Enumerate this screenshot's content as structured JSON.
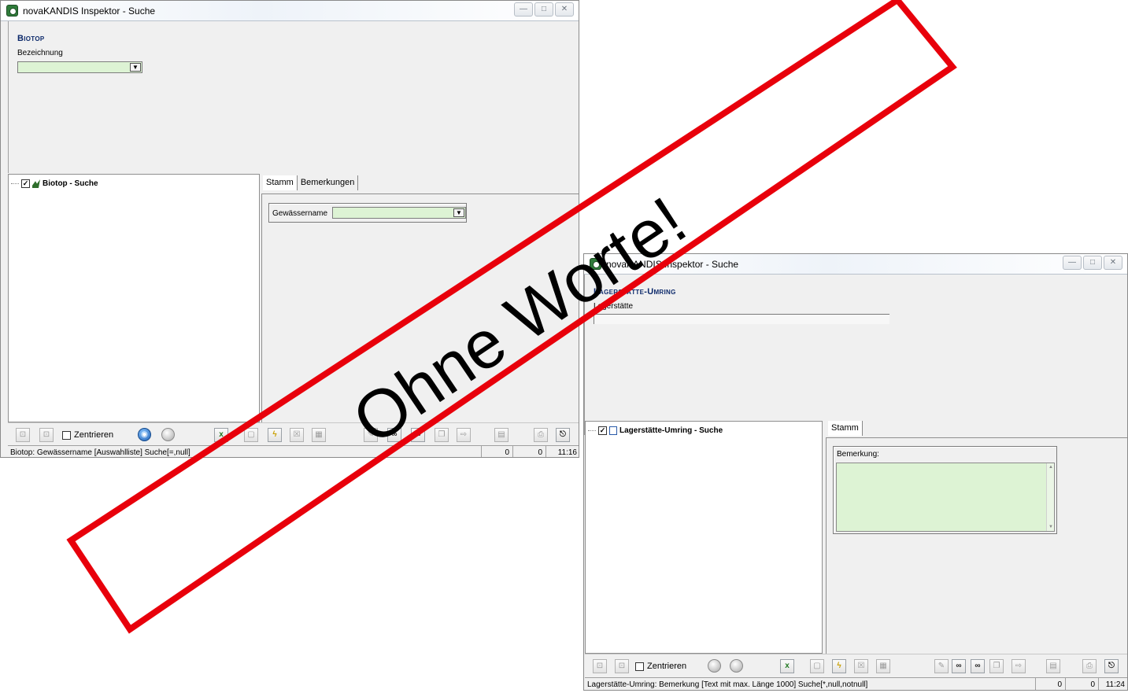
{
  "window1": {
    "title": "novaKANDIS Inspektor - Suche",
    "window_controls": [
      "—",
      "□",
      "✕"
    ],
    "section_title": "Biotop",
    "field_label": "Bezeichnung",
    "tree_node": "Biotop - Suche",
    "tabs": [
      "Stamm",
      "Bemerkungen"
    ],
    "gewaesser_label": "Gewässername",
    "zentrieren_label": "Zentrieren",
    "status_text": "Biotop: Gewässername [Auswahlliste] Suche[=,null]",
    "status_count1": "0",
    "status_count2": "0",
    "status_time": "11:16"
  },
  "window2": {
    "title": "novaKANDIS Inspektor - Suche",
    "window_controls": [
      "—",
      "□",
      "✕"
    ],
    "section_title": "Lagerstätte-Umring",
    "field_label": "Lagerstätte",
    "tree_node": "Lagerstätte-Umring - Suche",
    "tabs": [
      "Stamm"
    ],
    "bemerkung_label": "Bemerkung:",
    "zentrieren_label": "Zentrieren",
    "status_text": "Lagerstätte-Umring: Bemerkung [Text mit max. Länge 1000] Suche[*,null,notnull]",
    "status_count1": "0",
    "status_count2": "0",
    "status_time": "11:24"
  },
  "stamp": {
    "text": "Ohne Worte!",
    "color": "#e8000b"
  },
  "colors": {
    "field_green": "#ddf3d4",
    "title_blue": "#0d2a6b",
    "window_bg": "#f0f0f0"
  }
}
